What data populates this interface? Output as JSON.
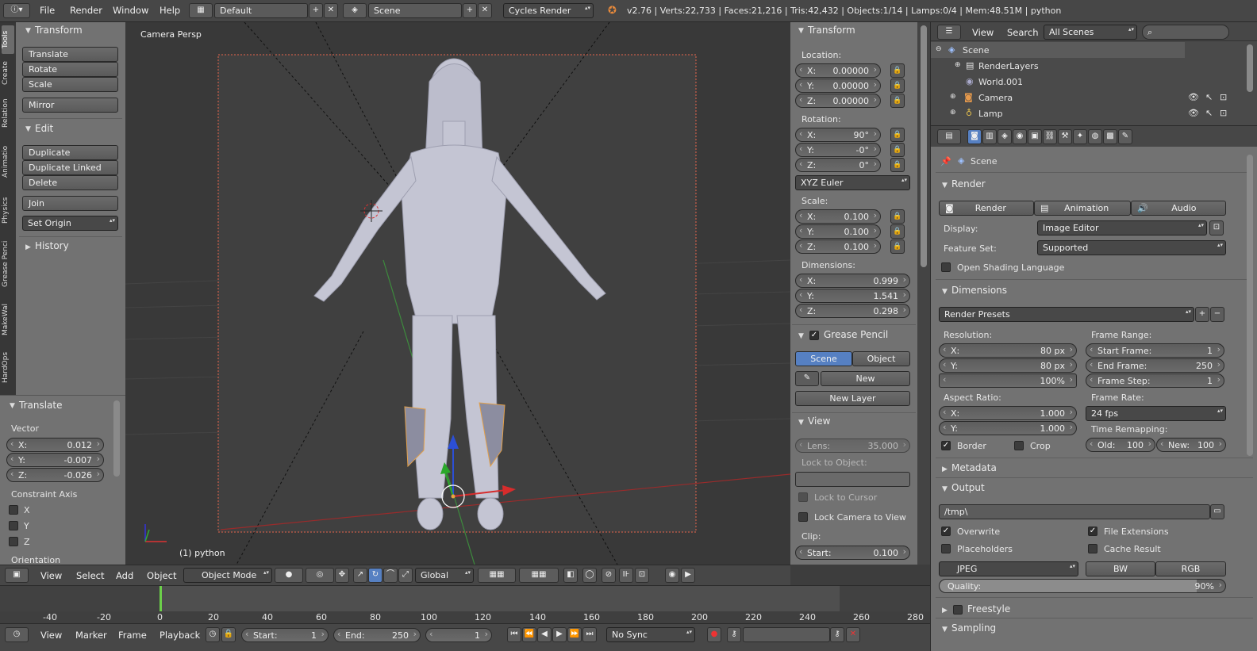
{
  "topbar": {
    "menus": [
      "File",
      "Render",
      "Window",
      "Help"
    ],
    "layout": "Default",
    "scene": "Scene",
    "engine": "Cycles Render",
    "stats": "v2.76 | Verts:22,733 | Faces:21,216 | Tris:42,432 | Objects:1/14 | Lamps:0/4 | Mem:48.51M | python"
  },
  "tools": {
    "tabs": [
      "Tools",
      "Create",
      "Relation",
      "Animatio",
      "Physics",
      "Grease Penci",
      "MakeWal",
      "HardOps"
    ],
    "transform_title": "Transform",
    "transform_buttons": [
      "Translate",
      "Rotate",
      "Scale"
    ],
    "mirror": "Mirror",
    "edit_title": "Edit",
    "edit_buttons": [
      "Duplicate",
      "Duplicate Linked",
      "Delete"
    ],
    "join": "Join",
    "set_origin": "Set Origin",
    "history": "History"
  },
  "operator": {
    "title": "Translate",
    "vector_label": "Vector",
    "vector": [
      {
        "axis": "X:",
        "value": "0.012"
      },
      {
        "axis": "Y:",
        "value": "-0.007"
      },
      {
        "axis": "Z:",
        "value": "-0.026"
      }
    ],
    "constraint_label": "Constraint Axis",
    "constraints": [
      "X",
      "Y",
      "Z"
    ],
    "orientation": "Orientation"
  },
  "viewport": {
    "label": "Camera Persp",
    "object_label": "(1) python",
    "header": {
      "menus": [
        "View",
        "Select",
        "Add",
        "Object"
      ],
      "mode": "Object Mode",
      "orientation": "Global"
    }
  },
  "npanel": {
    "transform_title": "Transform",
    "location_label": "Location:",
    "location": [
      {
        "axis": "X:",
        "value": "0.00000"
      },
      {
        "axis": "Y:",
        "value": "0.00000"
      },
      {
        "axis": "Z:",
        "value": "0.00000"
      }
    ],
    "rotation_label": "Rotation:",
    "rotation": [
      {
        "axis": "X:",
        "value": "90°"
      },
      {
        "axis": "Y:",
        "value": "-0°"
      },
      {
        "axis": "Z:",
        "value": "0°"
      }
    ],
    "euler": "XYZ Euler",
    "scale_label": "Scale:",
    "scale": [
      {
        "axis": "X:",
        "value": "0.100"
      },
      {
        "axis": "Y:",
        "value": "0.100"
      },
      {
        "axis": "Z:",
        "value": "0.100"
      }
    ],
    "dimensions_label": "Dimensions:",
    "dimensions": [
      {
        "axis": "X:",
        "value": "0.999"
      },
      {
        "axis": "Y:",
        "value": "1.541"
      },
      {
        "axis": "Z:",
        "value": "0.298"
      }
    ],
    "grease_title": "Grease Pencil",
    "gp_scene": "Scene",
    "gp_object": "Object",
    "gp_new": "New",
    "gp_new_layer": "New Layer",
    "view_title": "View",
    "lens_label": "Lens:",
    "lens_value": "35.000",
    "lock_object_label": "Lock to Object:",
    "lock_cursor": "Lock to Cursor",
    "lock_camera": "Lock Camera to View",
    "clip_label": "Clip:",
    "clip_start_label": "Start:",
    "clip_start_value": "0.100"
  },
  "outliner": {
    "menus": [
      "View",
      "Search"
    ],
    "filter": "All Scenes",
    "items": [
      {
        "name": "Scene"
      },
      {
        "name": "RenderLayers"
      },
      {
        "name": "World.001"
      },
      {
        "name": "Camera"
      },
      {
        "name": "Lamp"
      }
    ]
  },
  "properties": {
    "context": "Scene",
    "render_title": "Render",
    "render_btn": "Render",
    "animation_btn": "Animation",
    "audio_btn": "Audio",
    "display_label": "Display:",
    "display_value": "Image Editor",
    "feature_label": "Feature Set:",
    "feature_value": "Supported",
    "osl": "Open Shading Language",
    "dimensions_title": "Dimensions",
    "presets": "Render Presets",
    "resolution_label": "Resolution:",
    "res_x_label": "X:",
    "res_x": "80 px",
    "res_y_label": "Y:",
    "res_y": "80 px",
    "res_pct": "100%",
    "frame_range_label": "Frame Range:",
    "start_frame_label": "Start Frame:",
    "start_frame": "1",
    "end_frame_label": "End Frame:",
    "end_frame": "250",
    "frame_step_label": "Frame Step:",
    "frame_step": "1",
    "aspect_label": "Aspect Ratio:",
    "asp_x_label": "X:",
    "asp_x": "1.000",
    "asp_y_label": "Y:",
    "asp_y": "1.000",
    "frame_rate_label": "Frame Rate:",
    "fps": "24 fps",
    "time_remap_label": "Time Remapping:",
    "old_label": "Old:",
    "old_value": "100",
    "new_label": "New:",
    "new_value": "100",
    "border": "Border",
    "crop": "Crop",
    "metadata_title": "Metadata",
    "output_title": "Output",
    "output_path": "/tmp\\",
    "overwrite": "Overwrite",
    "file_ext": "File Extensions",
    "placeholders": "Placeholders",
    "cache_result": "Cache Result",
    "format": "JPEG",
    "bw": "BW",
    "rgb": "RGB",
    "quality_label": "Quality:",
    "quality_value": "90%",
    "quality_fraction": 0.9,
    "freestyle_title": "Freestyle",
    "sampling_title": "Sampling"
  },
  "timeline": {
    "ticks": [
      "-40",
      "-20",
      "0",
      "20",
      "40",
      "60",
      "80",
      "100",
      "120",
      "140",
      "160",
      "180",
      "200",
      "220",
      "240",
      "260",
      "280"
    ],
    "menus": [
      "View",
      "Marker",
      "Frame",
      "Playback"
    ],
    "start_label": "Start:",
    "start_value": "1",
    "end_label": "End:",
    "end_value": "250",
    "current": "1",
    "sync": "No Sync"
  },
  "colors": {
    "background": "#3d3d3d",
    "panel": "#727272",
    "accent_blue": "#5680c2",
    "viewport": "#393939",
    "camera_frame": "#e8654b"
  }
}
